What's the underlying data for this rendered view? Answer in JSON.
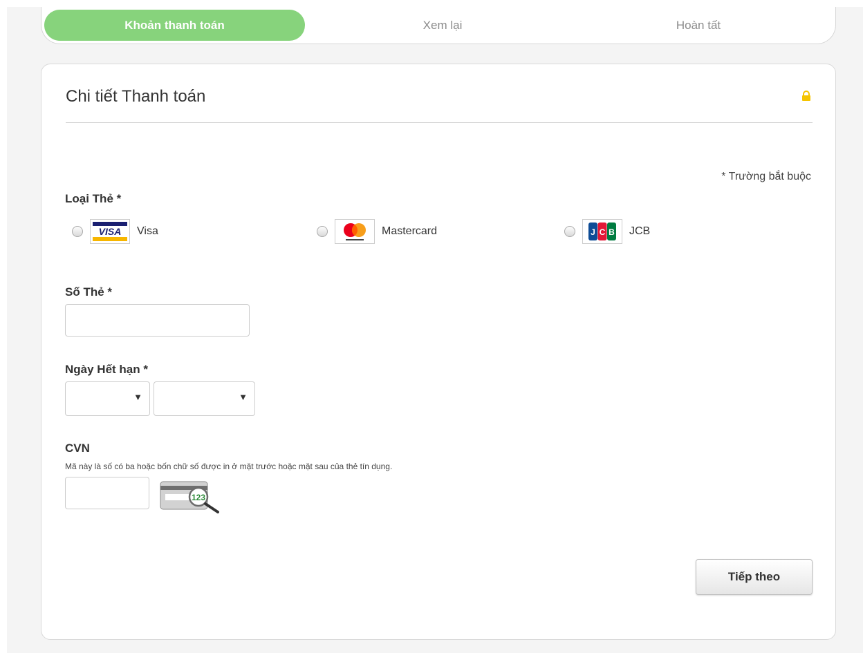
{
  "stepper": {
    "steps": [
      {
        "label": "Khoản thanh toán",
        "active": true
      },
      {
        "label": "Xem lại",
        "active": false
      },
      {
        "label": "Hoàn tất",
        "active": false
      }
    ]
  },
  "card": {
    "title": "Chi tiết Thanh toán",
    "required_note": "* Trường bắt buộc",
    "card_type": {
      "label": "Loại Thẻ *",
      "options": [
        {
          "name": "Visa",
          "icon": "visa-logo"
        },
        {
          "name": "Mastercard",
          "icon": "mastercard-logo"
        },
        {
          "name": "JCB",
          "icon": "jcb-logo"
        }
      ]
    },
    "card_number": {
      "label": "Số Thẻ *",
      "value": ""
    },
    "expiry": {
      "label": "Ngày Hết hạn *",
      "month": "",
      "year": ""
    },
    "cvn": {
      "label": "CVN",
      "help": "Mã này là số có ba hoặc bốn chữ số được in ở mặt trước hoặc mặt sau của thẻ tín dụng.",
      "value": "",
      "example_digits": "123"
    },
    "next_button": "Tiếp theo"
  },
  "colors": {
    "accent": "#87d37c",
    "lock": "#f5c400"
  }
}
